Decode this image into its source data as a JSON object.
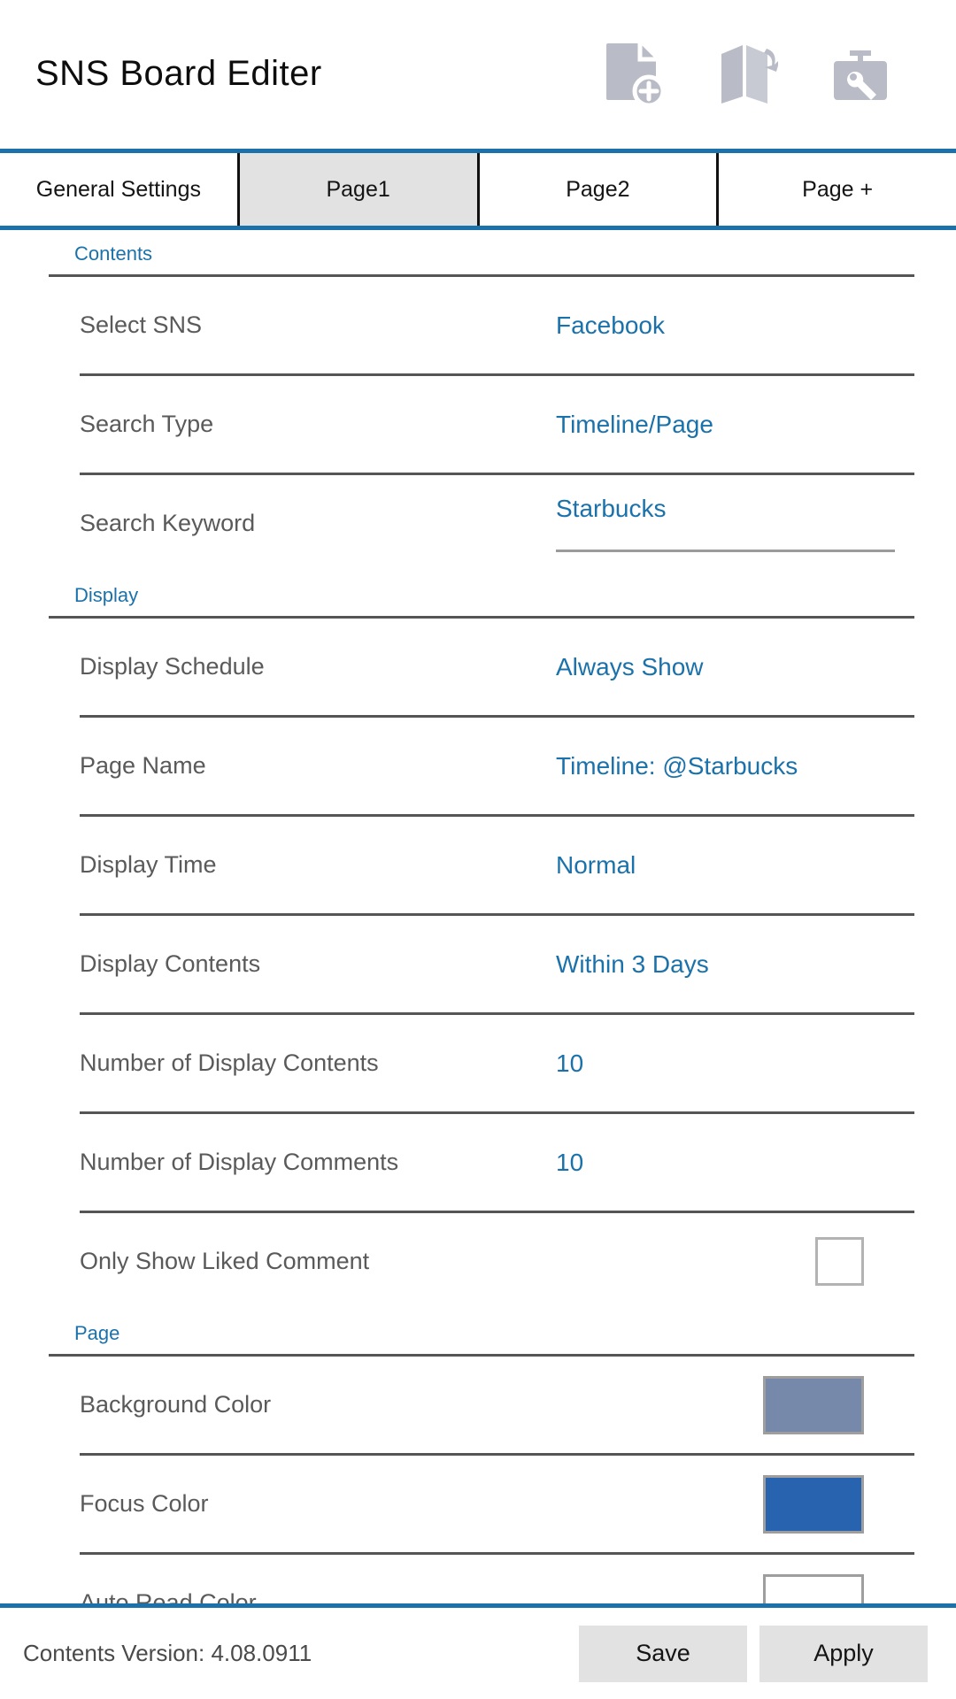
{
  "header": {
    "title": "SNS Board Editer",
    "icons": [
      {
        "name": "new-document-icon",
        "label": "New"
      },
      {
        "name": "open-book-icon",
        "label": "Open"
      },
      {
        "name": "toolbox-wrench-icon",
        "label": "Tools"
      }
    ]
  },
  "tabs": [
    {
      "label": "General Settings",
      "active": false
    },
    {
      "label": "Page1",
      "active": true
    },
    {
      "label": "Page2",
      "active": false
    },
    {
      "label": "Page +",
      "active": false
    }
  ],
  "sections": [
    {
      "label": "Contents",
      "rows": [
        {
          "label": "Select SNS",
          "value": "Facebook",
          "type": "select"
        },
        {
          "label": "Search Type",
          "value": "Timeline/Page",
          "type": "select"
        },
        {
          "label": "Search Keyword",
          "value": "Starbucks",
          "type": "text-input"
        }
      ]
    },
    {
      "label": "Display",
      "rows": [
        {
          "label": "Display Schedule",
          "value": "Always Show",
          "type": "select"
        },
        {
          "label": "Page Name",
          "value": "Timeline: @Starbucks",
          "type": "select"
        },
        {
          "label": "Display Time",
          "value": "Normal",
          "type": "select"
        },
        {
          "label": "Display Contents",
          "value": "Within 3 Days",
          "type": "select"
        },
        {
          "label": "Number of Display Contents",
          "value": "10",
          "type": "select"
        },
        {
          "label": "Number of Display Comments",
          "value": "10",
          "type": "select"
        },
        {
          "label": "Only Show Liked Comment",
          "value": "",
          "type": "checkbox",
          "checked": false
        }
      ]
    },
    {
      "label": "Page",
      "rows": [
        {
          "label": "Background Color",
          "value": "",
          "type": "color",
          "color": "#7689ab"
        },
        {
          "label": "Focus Color",
          "value": "",
          "type": "color",
          "color": "#2763ae"
        },
        {
          "label": "Auto Read Color",
          "value": "",
          "type": "color",
          "color": "#ffffff"
        }
      ]
    }
  ],
  "footer": {
    "version": "Contents Version: 4.08.0911",
    "save_label": "Save",
    "apply_label": "Apply"
  },
  "theme": {
    "accent": "#1b72ab",
    "label_gray": "#5a5a5a",
    "rule_gray": "#555555",
    "tab_active_bg": "#e2e2e2",
    "button_bg": "#e2e2e2",
    "icon_gray": "#b9bcc6"
  }
}
